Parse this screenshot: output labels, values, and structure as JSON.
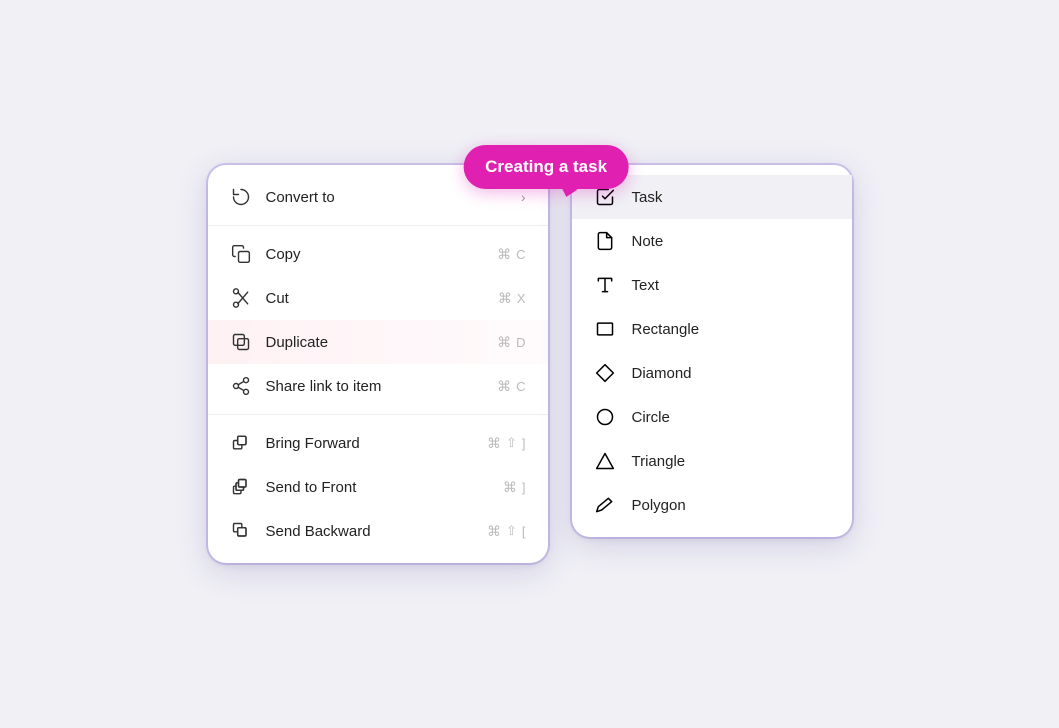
{
  "tooltip": {
    "text": "Creating a task"
  },
  "left_menu": {
    "items": [
      {
        "id": "convert-to",
        "label": "Convert to",
        "icon": "convert-icon",
        "shortcut": null,
        "has_chevron": true,
        "highlighted": false
      },
      {
        "id": "copy",
        "label": "Copy",
        "icon": "copy-icon",
        "shortcut": {
          "sym": "⌘",
          "key": "C"
        },
        "has_chevron": false,
        "highlighted": false
      },
      {
        "id": "cut",
        "label": "Cut",
        "icon": "cut-icon",
        "shortcut": {
          "sym": "⌘",
          "key": "X"
        },
        "has_chevron": false,
        "highlighted": false
      },
      {
        "id": "duplicate",
        "label": "Duplicate",
        "icon": "duplicate-icon",
        "shortcut": {
          "sym": "⌘",
          "key": "D"
        },
        "has_chevron": false,
        "highlighted": true
      },
      {
        "id": "share-link",
        "label": "Share link to item",
        "icon": "share-icon",
        "shortcut": {
          "sym": "⌘",
          "key": "C"
        },
        "has_chevron": false,
        "highlighted": false
      }
    ],
    "items2": [
      {
        "id": "bring-forward",
        "label": "Bring Forward",
        "icon": "bring-forward-icon",
        "shortcut": {
          "sym": "⌘",
          "shift": "⇧",
          "key": "]"
        },
        "has_chevron": false
      },
      {
        "id": "send-to-front",
        "label": "Send to Front",
        "icon": "send-front-icon",
        "shortcut": {
          "sym": "⌘",
          "key": "]"
        },
        "has_chevron": false
      },
      {
        "id": "send-backward",
        "label": "Send Backward",
        "icon": "send-backward-icon",
        "shortcut": {
          "sym": "⌘",
          "shift": "⇧",
          "key": "["
        },
        "has_chevron": false
      }
    ]
  },
  "right_menu": {
    "items": [
      {
        "id": "task",
        "label": "Task",
        "icon": "task-icon",
        "active": true
      },
      {
        "id": "note",
        "label": "Note",
        "icon": "note-icon",
        "active": false
      },
      {
        "id": "text",
        "label": "Text",
        "icon": "text-icon",
        "active": false
      },
      {
        "id": "rectangle",
        "label": "Rectangle",
        "icon": "rectangle-icon",
        "active": false
      },
      {
        "id": "diamond",
        "label": "Diamond",
        "icon": "diamond-icon",
        "active": false
      },
      {
        "id": "circle",
        "label": "Circle",
        "icon": "circle-icon",
        "active": false
      },
      {
        "id": "triangle",
        "label": "Triangle",
        "icon": "triangle-icon",
        "active": false
      },
      {
        "id": "polygon",
        "label": "Polygon",
        "icon": "polygon-icon",
        "active": false
      }
    ]
  }
}
